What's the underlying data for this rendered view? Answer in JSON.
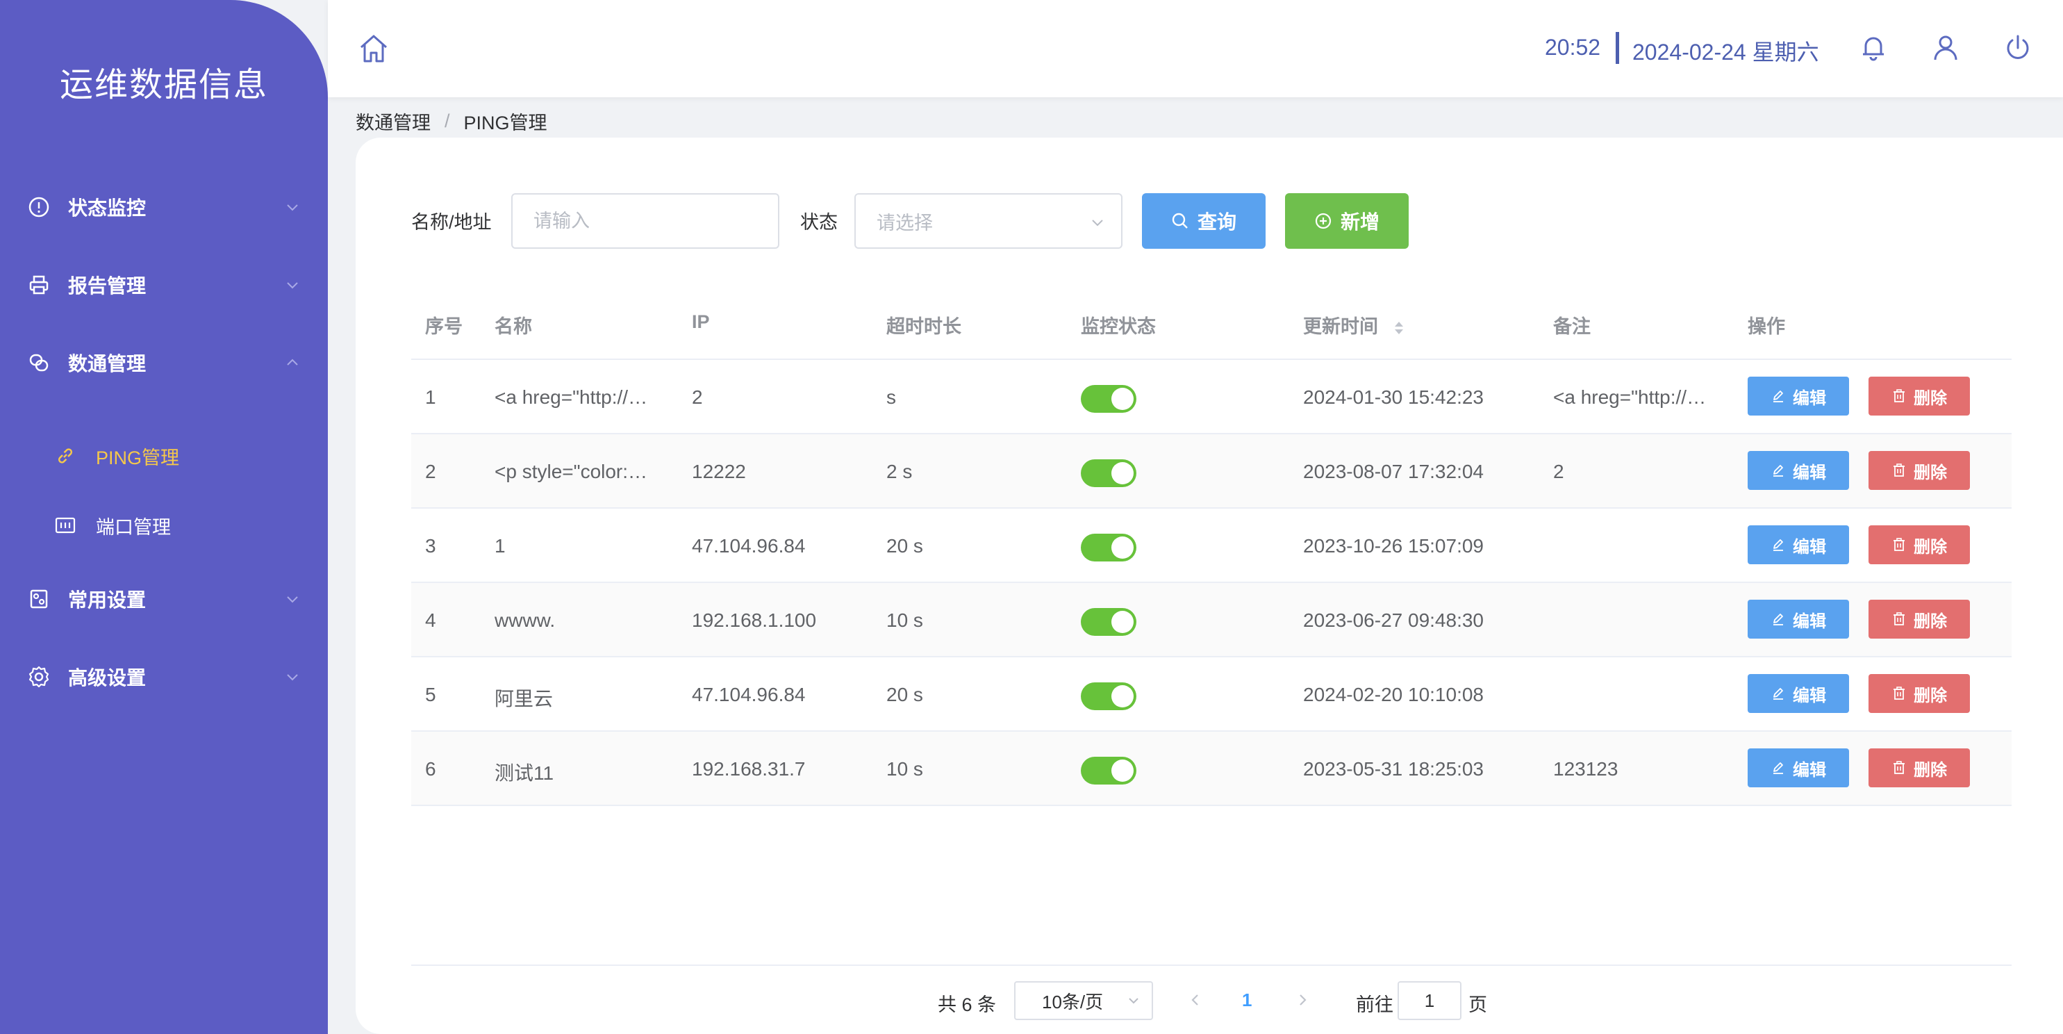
{
  "app": {
    "title": "运维数据信息"
  },
  "sidebar": {
    "items": [
      {
        "label": "状态监控",
        "icon": "alert-circle-icon",
        "expanded": false
      },
      {
        "label": "报告管理",
        "icon": "printer-icon",
        "expanded": false
      },
      {
        "label": "数通管理",
        "icon": "link-circles-icon",
        "expanded": true,
        "children": [
          {
            "label": "PING管理",
            "icon": "link-icon",
            "active": true
          },
          {
            "label": "端口管理",
            "icon": "port-icon",
            "active": false
          }
        ]
      },
      {
        "label": "常用设置",
        "icon": "settings-panel-icon",
        "expanded": false
      },
      {
        "label": "高级设置",
        "icon": "gear-icon",
        "expanded": false
      }
    ]
  },
  "header": {
    "time": "20:52",
    "date": "2024-02-24 星期六",
    "icons": [
      "home-icon",
      "bell-icon",
      "user-icon",
      "power-icon"
    ]
  },
  "breadcrumb": {
    "parent": "数通管理",
    "separator": "/",
    "current": "PING管理"
  },
  "filters": {
    "name_label": "名称/地址",
    "name_placeholder": "请输入",
    "status_label": "状态",
    "status_placeholder": "请选择",
    "query_button": "查询",
    "add_button": "新增"
  },
  "table": {
    "columns": [
      "序号",
      "名称",
      "IP",
      "超时时长",
      "监控状态",
      "更新时间",
      "备注",
      "操作"
    ],
    "edit_label": "编辑",
    "delete_label": "删除",
    "rows": [
      {
        "index": "1",
        "name": "<a hreg=\"http://…",
        "ip": "2",
        "timeout": "s",
        "enabled": true,
        "updated": "2024-01-30 15:42:23",
        "remark": "<a hreg=\"http://…"
      },
      {
        "index": "2",
        "name": "<p style=\"color:…",
        "ip": "12222",
        "timeout": "2 s",
        "enabled": true,
        "updated": "2023-08-07 17:32:04",
        "remark": "2"
      },
      {
        "index": "3",
        "name": "1",
        "ip": "47.104.96.84",
        "timeout": "20 s",
        "enabled": true,
        "updated": "2023-10-26 15:07:09",
        "remark": ""
      },
      {
        "index": "4",
        "name": "wwww.",
        "ip": "192.168.1.100",
        "timeout": "10 s",
        "enabled": true,
        "updated": "2023-06-27 09:48:30",
        "remark": ""
      },
      {
        "index": "5",
        "name": "阿里云",
        "ip": "47.104.96.84",
        "timeout": "20 s",
        "enabled": true,
        "updated": "2024-02-20 10:10:08",
        "remark": ""
      },
      {
        "index": "6",
        "name": "测试11",
        "ip": "192.168.31.7",
        "timeout": "10 s",
        "enabled": true,
        "updated": "2023-05-31 18:25:03",
        "remark": "123123"
      }
    ]
  },
  "pagination": {
    "total_text": "共 6 条",
    "page_size": "10条/页",
    "current_page": "1",
    "goto_label": "前往",
    "goto_value": "1",
    "page_suffix": "页"
  },
  "colors": {
    "sidebar_bg": "#5c5cc4",
    "accent": "#4d5fb0",
    "active_menu": "#f5c84a",
    "primary_button": "#5aa2ef",
    "success_button": "#6fbf4d",
    "danger_button": "#e36f6f",
    "switch_on": "#67c23a"
  }
}
